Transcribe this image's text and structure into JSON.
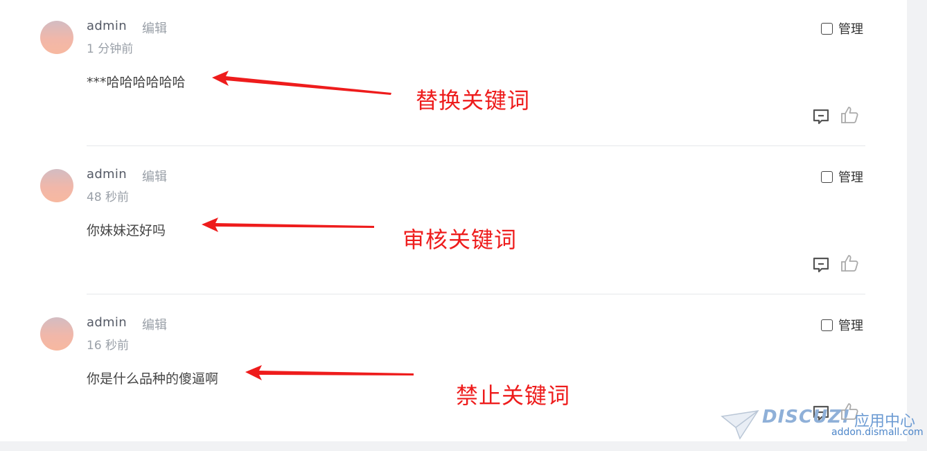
{
  "comments": [
    {
      "author": "admin",
      "edit_label": "编辑",
      "time": "1 分钟前",
      "content": "***哈哈哈哈哈哈",
      "manage_label": "管理",
      "annotation": "替换关键词"
    },
    {
      "author": "admin",
      "edit_label": "编辑",
      "time": "48 秒前",
      "content": "你妹妹还好吗",
      "manage_label": "管理",
      "annotation": "审核关键词"
    },
    {
      "author": "admin",
      "edit_label": "编辑",
      "time": "16 秒前",
      "content": "你是什么品种的傻逼啊",
      "manage_label": "管理",
      "annotation": "禁止关键词"
    }
  ],
  "watermark": {
    "brand": "DISCUZ!",
    "center": "应用中心",
    "url": "addon.dismall.com"
  },
  "colors": {
    "annotation": "#ee1c1c",
    "background": "#f1f2f4"
  },
  "icons": {
    "reply": "comment-reply-icon",
    "like": "thumbs-up-icon"
  }
}
